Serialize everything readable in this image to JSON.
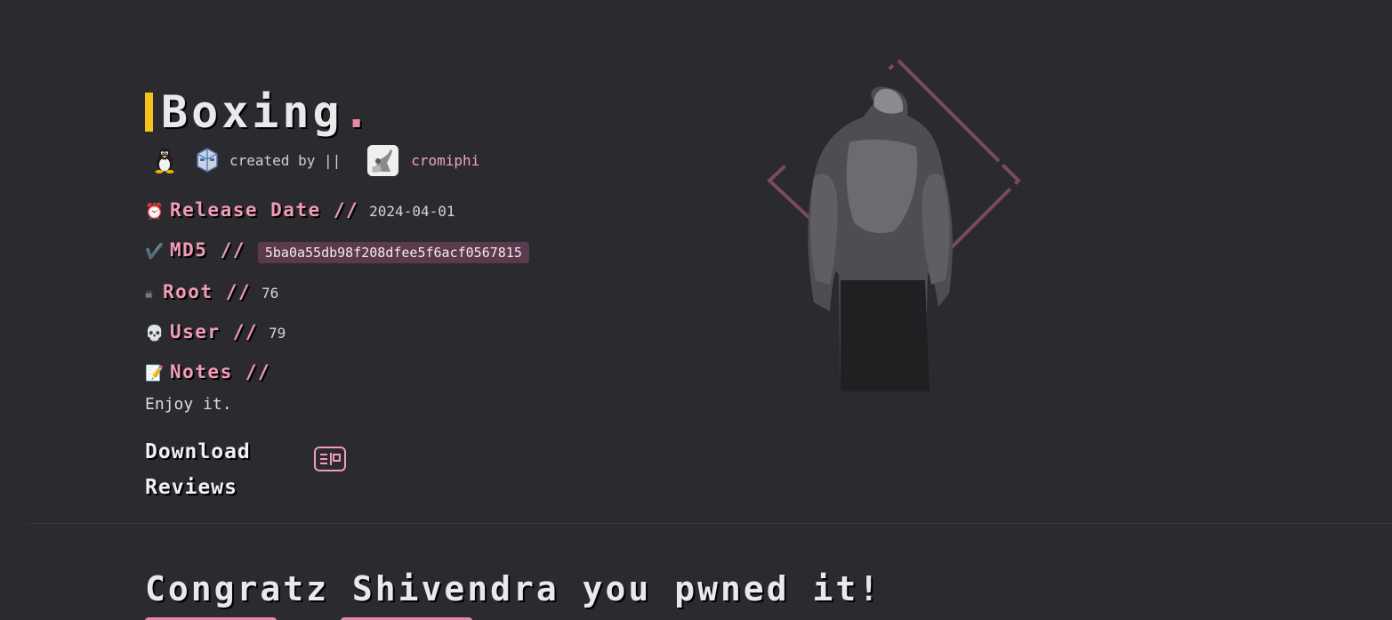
{
  "machine": {
    "title": "Boxing",
    "title_suffix": ".",
    "created_by_label": "created by ||",
    "author": "cromiphi"
  },
  "info": {
    "release_label": "Release Date //",
    "release_value": "2024-04-01",
    "md5_label": "MD5 //",
    "md5_value": "5ba0a55db98f208dfee5f6acf0567815",
    "root_label": "Root //",
    "root_value": "76",
    "user_label": "User //",
    "user_value": "79",
    "notes_label": "Notes //",
    "notes_value": "Enjoy it."
  },
  "icons": {
    "os": "linux-tux-icon",
    "vm": "virtualbox-icon",
    "release": "alarm-clock-icon",
    "md5": "check-mark-icon",
    "root": "skull-crossbones-icon",
    "user": "skull-icon",
    "notes": "memo-icon",
    "download": "vm-download-icon"
  },
  "actions": {
    "download_label": "Download",
    "reviews_label": "Reviews"
  },
  "congratz": "Congratz Shivendra you pwned it!",
  "colors": {
    "background": "#2a2a2f",
    "accent_pink": "#f29cb8",
    "title_bar_yellow": "#f4c21b",
    "md5_badge_bg": "#5a3a4c"
  }
}
